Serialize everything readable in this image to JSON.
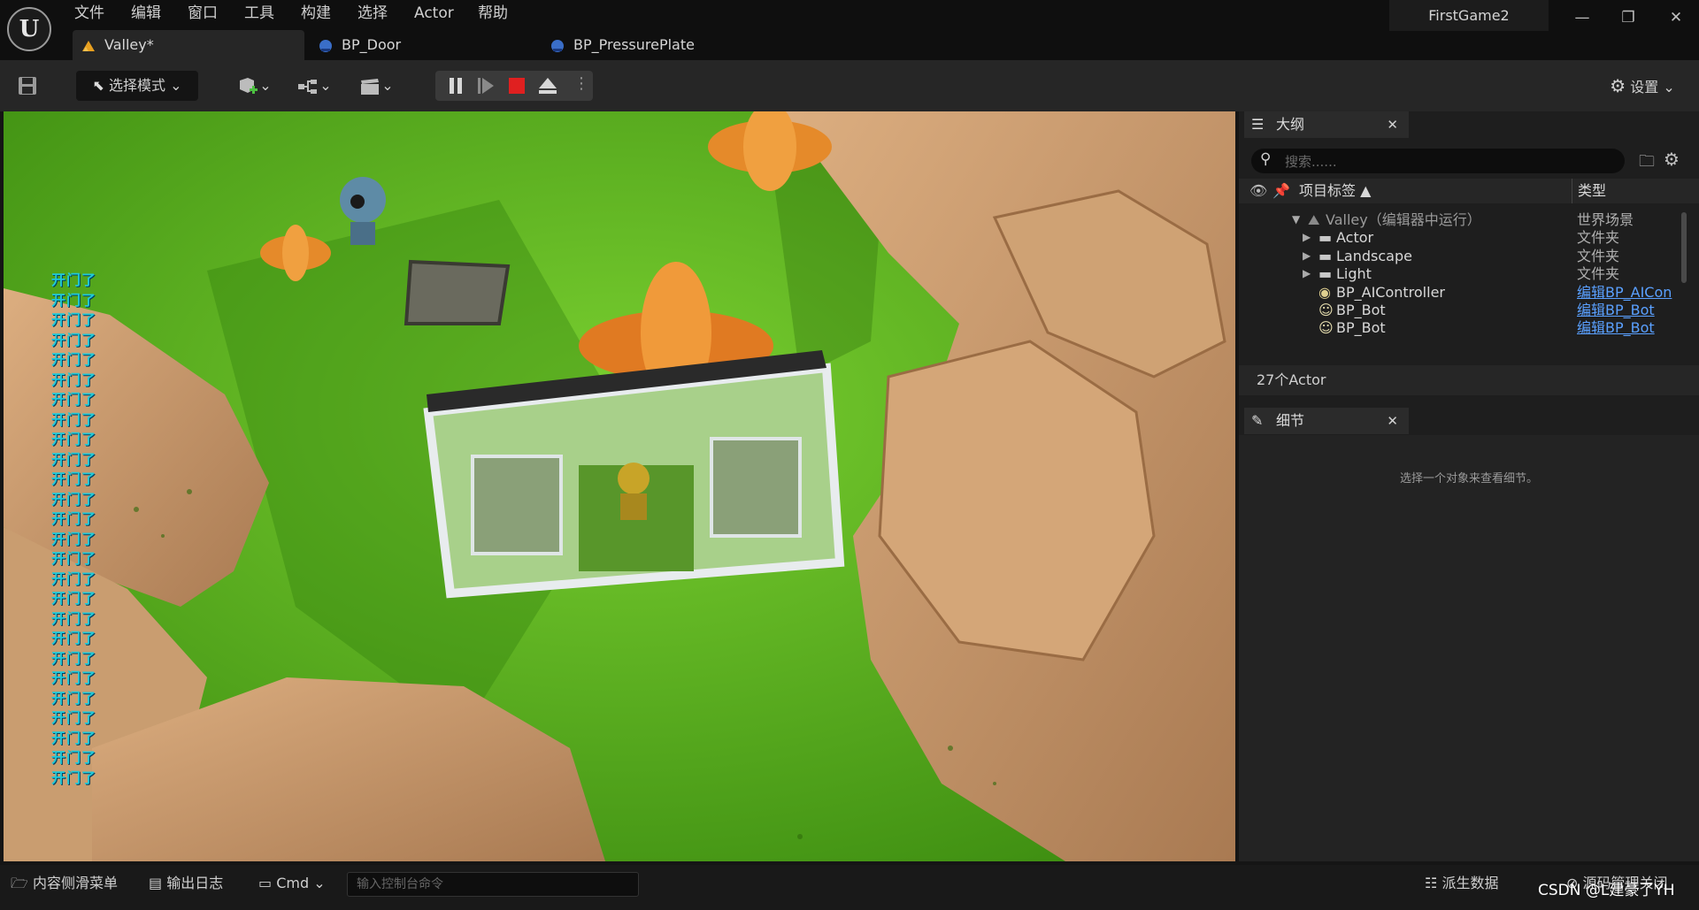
{
  "app": {
    "logo_text": "U",
    "project_name": "FirstGame2",
    "menu": [
      "文件",
      "编辑",
      "窗口",
      "工具",
      "构建",
      "选择",
      "Actor",
      "帮助"
    ],
    "tabs": [
      {
        "label": "Valley*",
        "active": true,
        "icon": "level-icon"
      },
      {
        "label": "BP_Door",
        "active": false,
        "icon": "blueprint-icon"
      },
      {
        "label": "BP_PressurePlate",
        "active": false,
        "icon": "blueprint-icon"
      }
    ],
    "window_controls": {
      "minimize": "—",
      "restore": "❐",
      "close": "✕"
    }
  },
  "toolbar": {
    "select_mode_label": "选择模式",
    "settings_label": "设置"
  },
  "viewport": {
    "log_line": "开门了",
    "log_count": 26
  },
  "outliner": {
    "tab_label": "大纲",
    "search_placeholder": "搜索......",
    "col_label": "项目标签 ▲",
    "col_type": "类型",
    "rows": [
      {
        "name": "Valley（编辑器中运行）",
        "type": "世界场景",
        "link": false,
        "icon": "world-icon",
        "indent": 0
      },
      {
        "name": "Actor",
        "type": "文件夹",
        "link": false,
        "icon": "folder-icon",
        "indent": 1
      },
      {
        "name": "Landscape",
        "type": "文件夹",
        "link": false,
        "icon": "folder-icon",
        "indent": 1
      },
      {
        "name": "Light",
        "type": "文件夹",
        "link": false,
        "icon": "folder-icon",
        "indent": 1
      },
      {
        "name": "BP_AIController",
        "type": "编辑BP_AICon",
        "link": true,
        "icon": "controller-icon",
        "indent": 1
      },
      {
        "name": "BP_Bot",
        "type": "编辑BP_Bot",
        "link": true,
        "icon": "pawn-icon",
        "indent": 1
      },
      {
        "name": "BP_Bot",
        "type": "编辑BP_Bot",
        "link": true,
        "icon": "pawn-icon",
        "indent": 1
      }
    ],
    "actor_count": "27个Actor"
  },
  "details": {
    "tab_label": "细节",
    "empty_text": "选择一个对象来查看细节。"
  },
  "bottombar": {
    "content_drawer": "内容侧滑菜单",
    "output_log": "输出日志",
    "cmd_label": "Cmd",
    "cmd_placeholder": "输入控制台命令",
    "derived_data": "派生数据",
    "source_control": "源码管理关闭"
  },
  "watermark": "CSDN @L建豪了YH",
  "colors": {
    "grass": "#5bb421",
    "rock": "#c79a6c",
    "log_text": "#20c8d8",
    "stop_red": "#e02020",
    "link_blue": "#5aa0ff"
  }
}
